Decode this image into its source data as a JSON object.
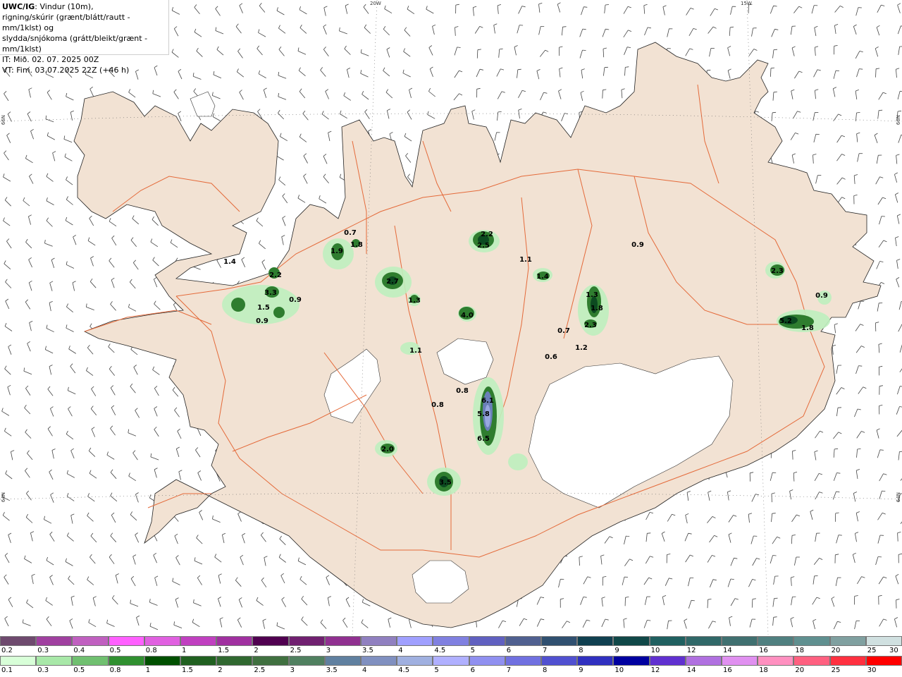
{
  "header": {
    "product": "UWC/IG",
    "line1_rest": ": Vindur (10m),",
    "line2": "rigning/skúrir (grænt/blátt/rautt - mm/1klst) og",
    "line3": "slydda/snjókoma (grátt/bleikt/grænt - mm/1klst)",
    "line4": "IT: Mið. 02. 07. 2025 00Z",
    "line5": "VT: Fim. 03.07.2025 22Z (+46 h)"
  },
  "grid_labels": {
    "lon_20w": "20W",
    "lon_15w": "15W",
    "lat_66n_left": "66N",
    "lat_66n_right": "66N",
    "lat_64n_left": "64N",
    "lat_64n_right": "64N"
  },
  "precip_amounts": [
    "0.7",
    "2.2",
    "2.5",
    "1.9",
    "1.8",
    "1.4",
    "2.2",
    "3.3",
    "1.5",
    "0.9",
    "0.9",
    "2.7",
    "1.3",
    "4.0",
    "1.1",
    "1.4",
    "0.9",
    "1.3",
    "1.8",
    "2.3",
    "0.7",
    "1.2",
    "0.6",
    "2.3",
    "0.9",
    "5.2",
    "1.8",
    "1.1",
    "0.8",
    "6.1",
    "5.8",
    "0.8",
    "6.5",
    "2.0",
    "3.5"
  ],
  "legend": {
    "snow": {
      "labels": [
        "0.2",
        "0.3",
        "0.4",
        "0.5",
        "0.8",
        "1",
        "1.5",
        "2",
        "2.5",
        "3",
        "3.5",
        "4",
        "4.5",
        "5",
        "6",
        "7",
        "8",
        "9",
        "10",
        "12",
        "14",
        "16",
        "18",
        "20",
        "25",
        "30"
      ],
      "colors": [
        "#6e4a6e",
        "#a040a0",
        "#c060c0",
        "#ff60ff",
        "#e060e0",
        "#c040c0",
        "#a030a0",
        "#500050",
        "#702070",
        "#903090",
        "#9080c0",
        "#a0a0ff",
        "#8080e0",
        "#6060c0",
        "#506090",
        "#305070",
        "#104050",
        "#104848",
        "#206060",
        "#306868",
        "#407070",
        "#508080",
        "#609090",
        "#80a0a0",
        "#d0e0e0"
      ]
    },
    "rain": {
      "labels": [
        "0.1",
        "0.3",
        "0.5",
        "0.8",
        "1",
        "1.5",
        "2",
        "2.5",
        "3",
        "3.5",
        "4",
        "4.5",
        "5",
        "6",
        "7",
        "8",
        "9",
        "10",
        "12",
        "14",
        "16",
        "18",
        "20",
        "25",
        "30"
      ],
      "colors": [
        "#d8ffd8",
        "#a8e8a8",
        "#70c070",
        "#309030",
        "#005000",
        "#206020",
        "#306830",
        "#407040",
        "#508060",
        "#6080a0",
        "#8090c0",
        "#a0b0e0",
        "#b0b0ff",
        "#9090f0",
        "#7070e0",
        "#5050d0",
        "#3030c0",
        "#0000a0",
        "#6030d0",
        "#b070e0",
        "#e090f0",
        "#ff90c0",
        "#ff6080",
        "#ff3040",
        "#ff0000"
      ]
    }
  }
}
